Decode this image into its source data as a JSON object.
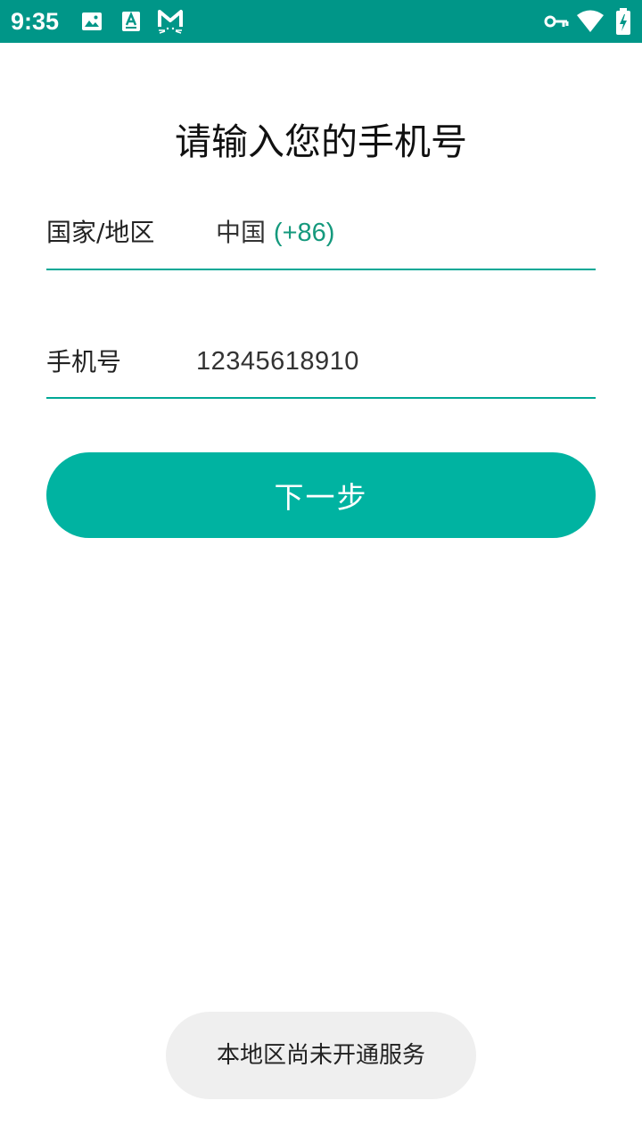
{
  "status_bar": {
    "time": "9:35",
    "left_icons": [
      "image-icon",
      "text-a-icon",
      "m-cat-icon"
    ],
    "right_icons": [
      "vpn-key-icon",
      "wifi-icon",
      "battery-charging-icon"
    ],
    "background_color": "#009688"
  },
  "page": {
    "title": "请输入您的手机号"
  },
  "form": {
    "country": {
      "label": "国家/地区",
      "name": "中国",
      "code": "(+86)"
    },
    "phone": {
      "label": "手机号",
      "value": "12345618910"
    },
    "accent_color": "#00a896"
  },
  "next_button": {
    "label": "下一步",
    "color": "#00b3a1"
  },
  "toast": {
    "message": "本地区尚未开通服务"
  }
}
